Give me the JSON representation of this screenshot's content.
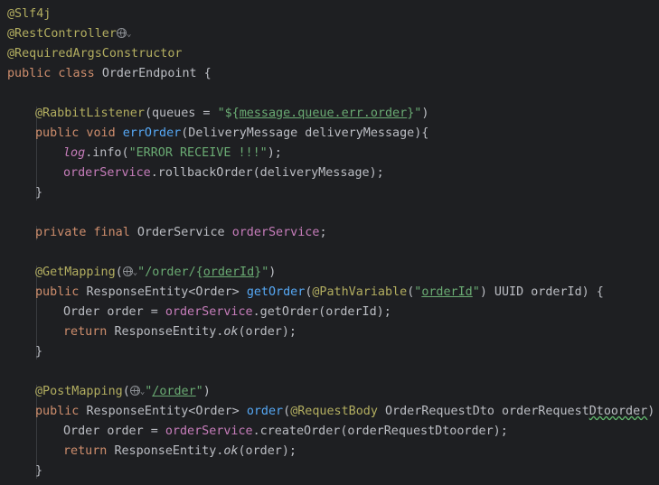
{
  "lines": [
    {
      "tokens": [
        {
          "t": "@Slf4j",
          "c": "ann"
        }
      ]
    },
    {
      "tokens": [
        {
          "t": "@RestController",
          "c": "ann"
        },
        {
          "icon": "globe"
        }
      ]
    },
    {
      "tokens": [
        {
          "t": "@RequiredArgsConstructor",
          "c": "ann"
        }
      ]
    },
    {
      "tokens": [
        {
          "t": "public class ",
          "c": "kw"
        },
        {
          "t": "OrderEndpoint {",
          "c": ""
        }
      ]
    },
    {
      "tokens": []
    },
    {
      "indent": 1,
      "tokens": [
        {
          "t": "@RabbitListener",
          "c": "ann"
        },
        {
          "t": "(queues = ",
          "c": ""
        },
        {
          "t": "\"${",
          "c": "str"
        },
        {
          "t": "message.queue.err.order",
          "c": "str-u"
        },
        {
          "t": "}\"",
          "c": "str"
        },
        {
          "t": ")",
          "c": ""
        }
      ]
    },
    {
      "indent": 1,
      "tokens": [
        {
          "t": "public void ",
          "c": "kw"
        },
        {
          "t": "errOrder",
          "c": "fn"
        },
        {
          "t": "(DeliveryMessage deliveryMessage){",
          "c": ""
        }
      ]
    },
    {
      "indent": 2,
      "tokens": [
        {
          "t": "log",
          "c": "log"
        },
        {
          "t": ".info(",
          "c": ""
        },
        {
          "t": "\"ERROR RECEIVE !!!\"",
          "c": "str"
        },
        {
          "t": ");",
          "c": ""
        }
      ]
    },
    {
      "indent": 2,
      "tokens": [
        {
          "t": "orderService",
          "c": "fld"
        },
        {
          "t": ".rollbackOrder(deliveryMessage);",
          "c": ""
        }
      ]
    },
    {
      "indent": 1,
      "tokens": [
        {
          "t": "}",
          "c": ""
        }
      ]
    },
    {
      "tokens": []
    },
    {
      "indent": 1,
      "tokens": [
        {
          "t": "private final ",
          "c": "kw"
        },
        {
          "t": "OrderService ",
          "c": ""
        },
        {
          "t": "orderService",
          "c": "fld"
        },
        {
          "t": ";",
          "c": ""
        }
      ]
    },
    {
      "tokens": []
    },
    {
      "indent": 1,
      "tokens": [
        {
          "t": "@GetMapping",
          "c": "ann"
        },
        {
          "t": "(",
          "c": ""
        },
        {
          "icon": "globe"
        },
        {
          "t": "\"/order/{",
          "c": "str"
        },
        {
          "t": "orderId",
          "c": "str-u"
        },
        {
          "t": "}\"",
          "c": "str"
        },
        {
          "t": ")",
          "c": ""
        }
      ]
    },
    {
      "indent": 1,
      "tokens": [
        {
          "t": "public ",
          "c": "kw"
        },
        {
          "t": "ResponseEntity<Order> ",
          "c": ""
        },
        {
          "t": "getOrder",
          "c": "fn"
        },
        {
          "t": "(",
          "c": ""
        },
        {
          "t": "@PathVariable",
          "c": "ann"
        },
        {
          "t": "(",
          "c": ""
        },
        {
          "t": "\"",
          "c": "str"
        },
        {
          "t": "orderId",
          "c": "str-u"
        },
        {
          "t": "\"",
          "c": "str"
        },
        {
          "t": ") UUID orderId) {",
          "c": ""
        }
      ]
    },
    {
      "indent": 2,
      "tokens": [
        {
          "t": "Order order = ",
          "c": ""
        },
        {
          "t": "orderService",
          "c": "fld"
        },
        {
          "t": ".getOrder(orderId);",
          "c": ""
        }
      ]
    },
    {
      "indent": 2,
      "tokens": [
        {
          "t": "return ",
          "c": "kw"
        },
        {
          "t": "ResponseEntity.",
          "c": ""
        },
        {
          "t": "ok",
          "c": "it"
        },
        {
          "t": "(order);",
          "c": ""
        }
      ]
    },
    {
      "indent": 1,
      "tokens": [
        {
          "t": "}",
          "c": ""
        }
      ]
    },
    {
      "tokens": []
    },
    {
      "indent": 1,
      "tokens": [
        {
          "t": "@PostMapping",
          "c": "ann"
        },
        {
          "t": "(",
          "c": ""
        },
        {
          "icon": "globe"
        },
        {
          "t": "\"",
          "c": "str"
        },
        {
          "t": "/order",
          "c": "str-u"
        },
        {
          "t": "\"",
          "c": "str"
        },
        {
          "t": ")",
          "c": ""
        }
      ]
    },
    {
      "indent": 1,
      "tokens": [
        {
          "t": "public ",
          "c": "kw"
        },
        {
          "t": "ResponseEntity<Order> ",
          "c": ""
        },
        {
          "t": "order",
          "c": "fn"
        },
        {
          "t": "(",
          "c": ""
        },
        {
          "t": "@RequestBody ",
          "c": "ann"
        },
        {
          "t": "OrderRequestDto orderRequest",
          "c": ""
        },
        {
          "t": "Dtoorder",
          "c": "warn"
        },
        {
          "t": ") {",
          "c": ""
        }
      ]
    },
    {
      "indent": 2,
      "tokens": [
        {
          "t": "Order order = ",
          "c": ""
        },
        {
          "t": "orderService",
          "c": "fld"
        },
        {
          "t": ".createOrder(orderRequestDtoorder);",
          "c": ""
        }
      ]
    },
    {
      "indent": 2,
      "tokens": [
        {
          "t": "return ",
          "c": "kw"
        },
        {
          "t": "ResponseEntity.",
          "c": ""
        },
        {
          "t": "ok",
          "c": "it"
        },
        {
          "t": "(order);",
          "c": ""
        }
      ]
    },
    {
      "indent": 1,
      "tokens": [
        {
          "t": "}",
          "c": ""
        }
      ]
    }
  ],
  "colors": {
    "background": "#1e1f22",
    "default": "#bcbec4",
    "annotation": "#b3ae60",
    "keyword": "#cf8e6d",
    "function": "#56a8f5",
    "field": "#c77dbb",
    "string": "#6aab73"
  }
}
